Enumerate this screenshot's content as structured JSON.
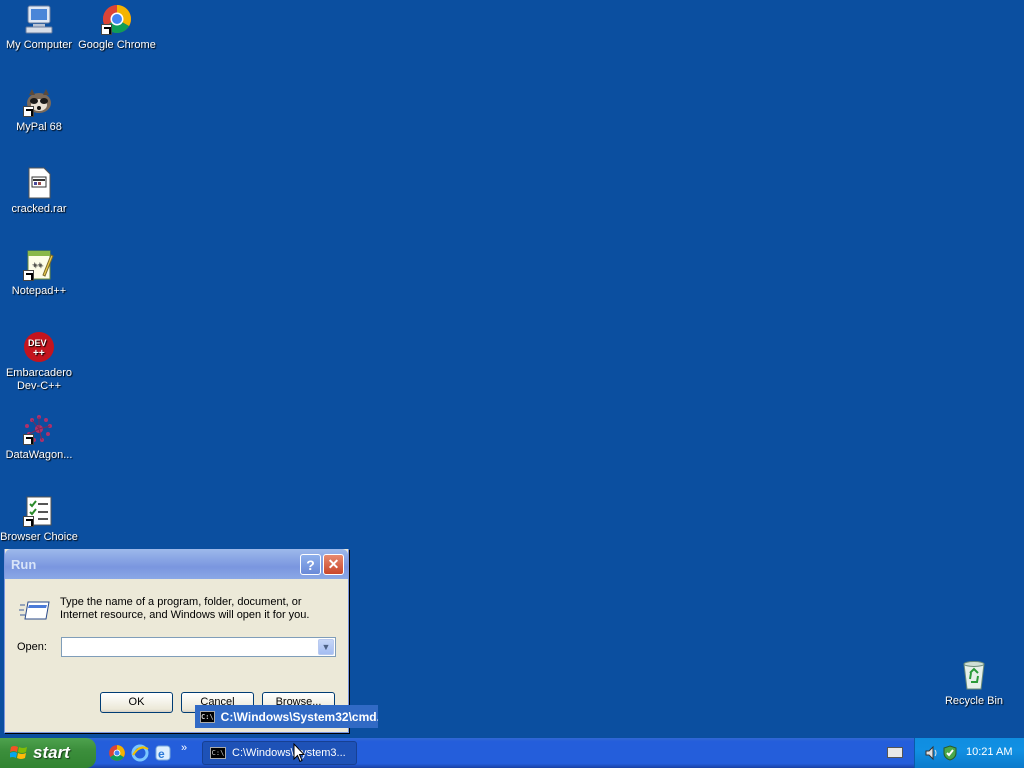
{
  "desktop": {
    "icons": [
      {
        "label": "My Computer",
        "icon": "computer-icon"
      },
      {
        "label": "Google Chrome",
        "icon": "chrome-icon"
      },
      {
        "label": "MyPal 68",
        "icon": "mypal-icon"
      },
      {
        "label": "cracked.rar",
        "icon": "rar-file-icon"
      },
      {
        "label": "Notepad++",
        "icon": "notepadpp-icon"
      },
      {
        "label": "Embarcadero Dev-C++",
        "icon": "devcpp-icon"
      },
      {
        "label": "DataWagon...",
        "icon": "datawagon-icon"
      },
      {
        "label": "Browser Choice",
        "icon": "checklist-icon"
      },
      {
        "label": "Recycle Bin",
        "icon": "recycle-bin-icon"
      }
    ]
  },
  "run_dialog": {
    "title": "Run",
    "help_label": "?",
    "close_label": "✕",
    "description": "Type the name of a program, folder, document, or Internet resource, and Windows will open it for you.",
    "open_label": "Open:",
    "open_value": "",
    "ok_label": "OK",
    "cancel_label": "Cancel",
    "browse_label": "Browse..."
  },
  "taskbar": {
    "start_label": "start",
    "chevron": "»",
    "task_label": "C:\\Windows\\System3...",
    "tooltip": "C:\\Windows\\System32\\cmd.exe",
    "clock": "10:21 AM",
    "cmd_glyph": "C:\\"
  }
}
